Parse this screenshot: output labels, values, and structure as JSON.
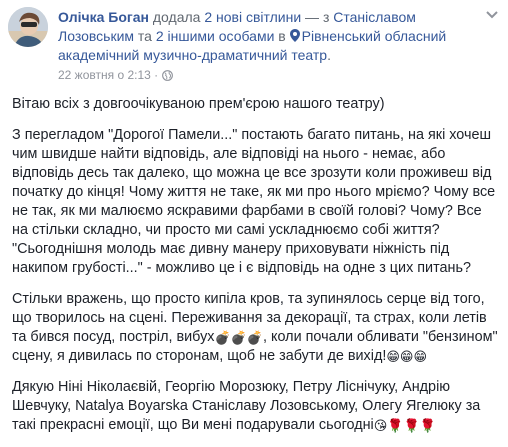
{
  "header": {
    "author": "Олічка Боган",
    "action_text": " додала ",
    "photos_link": "2 нові світлини",
    "with_text": " — з ",
    "tagged_person": "Станіславом Лозовським",
    "and_text": " та ",
    "others_link": "2 іншими особами",
    "in_text": " в ",
    "location": "Рівненський обласний академічний музично-драматичний театр",
    "period": ".",
    "timestamp": "22 жовтня о 2:13 ·",
    "privacy_icon": "globe-icon",
    "options_icon": "chevron-down-icon"
  },
  "post": {
    "p1": "Вітаю всіх з довгоочікуваною прем'єрою нашого театру)",
    "p2": "З перегладом \"Дорогої Памели...\" постають багато питань, на які хочеш чим швидше найти відповідь, але відповіді на нього - немає, або відповідь десь так далеко, що можна це все зрозути коли проживеш від початку до кінця! Чому життя не таке, як ми про нього мріємо? Чому все не так, як ми малюємо яскравими фарбами в своїй голові? Чому? Все на стільки складно, чи просто ми самі ускладнюємо собі життя? \"Сьогоднішня молодь має дивну манеру приховувати ніжність під накипом грубості...\" - можливо це і є відповідь на одне з цих питань?",
    "p3_a": "Стільки вражень, що просто кипіла кров, та зупинялось серце від того, що творилось на сцені. Переживання за декорації, та страх, коли летів та бився посуд, постріл, вибух",
    "p3_emoji_1": "💣💣💣",
    "p3_b": ", коли почали обливати \"бензином\" сцену, я дивилась по сторонам, щоб не забути де вихід!",
    "p3_emoji_2": "😁😁😁",
    "p4_a": "Дякую Ніні Ніколаєвій, Георгію Морозюку, Петру Ліснічуку, Андрію Шевчуку, Natalya Boyarska Станіславу Лозовському, Олегу Ягелюку за такі прекрасні емоції, що Ви мені подарували сьогодні",
    "p4_emoji": "😘🌹🌹🌹"
  },
  "colors": {
    "link": "#365899",
    "text": "#1d2129",
    "muted": "#90949c"
  }
}
